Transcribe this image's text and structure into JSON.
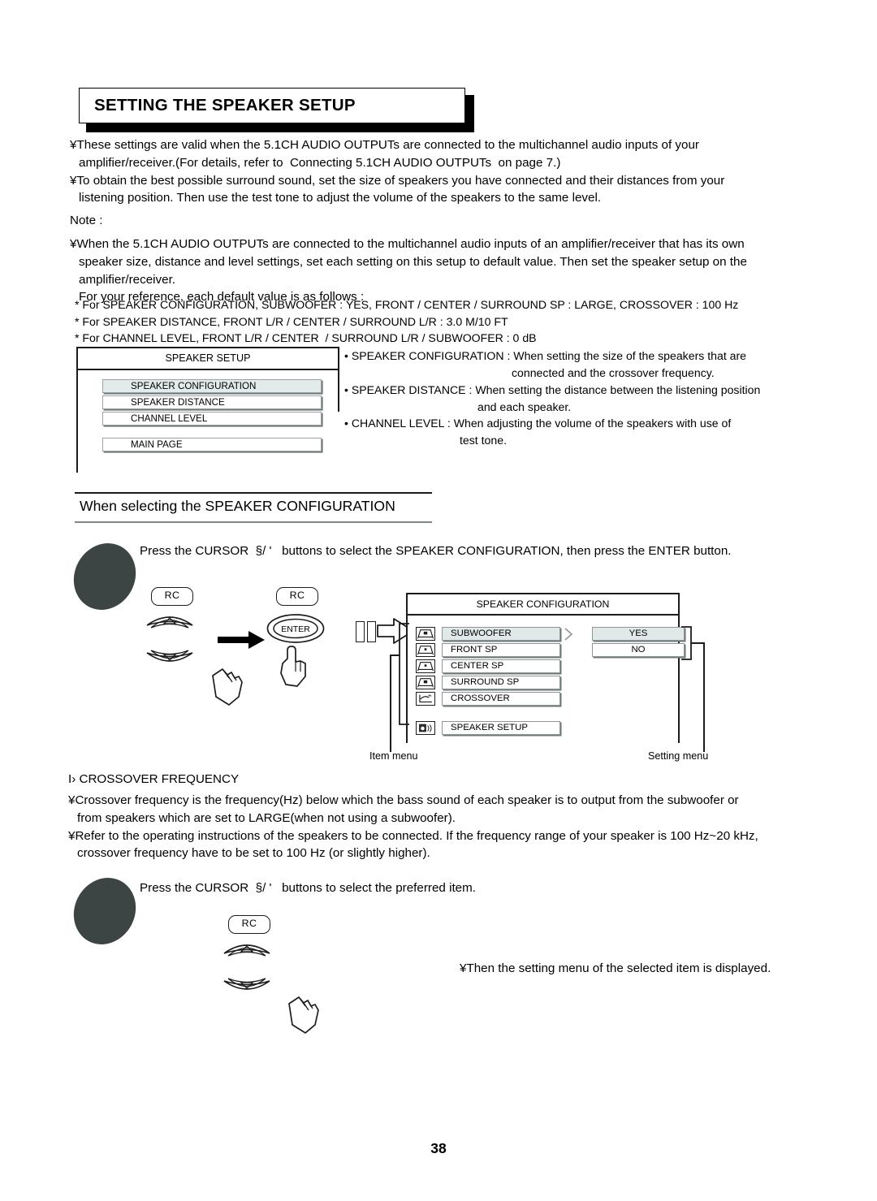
{
  "title": "SETTING THE SPEAKER SETUP",
  "page_number": "38",
  "intro": {
    "bullet1_line1": "¥These settings are valid when the 5.1CH AUDIO OUTPUTs are connected to the multichannel audio inputs of your",
    "bullet1_line2": "amplifier/receiver.(For details, refer to  Connecting 5.1CH AUDIO OUTPUTs  on page 7.)",
    "bullet2_line1": "¥To obtain the best possible surround sound, set the size of speakers you have connected and their distances from your",
    "bullet2_line2": "listening position. Then use the test tone to adjust the volume of the speakers to the same level."
  },
  "note": {
    "label": "Note :",
    "line1": "¥When the 5.1CH AUDIO OUTPUTs are connected to the multichannel audio inputs of an amplifier/receiver that has its own",
    "line2": "speaker size, distance and level settings, set each setting on this setup to default value. Then set the speaker setup on the",
    "line3": "amplifier/receiver.",
    "line4": "For your reference, each default value is as follows :",
    "default1": "* For SPEAKER CONFIGURATION, SUBWOOFER : YES, FRONT / CENTER / SURROUND SP : LARGE, CROSSOVER : 100 Hz",
    "default2": "* For SPEAKER DISTANCE, FRONT L/R / CENTER / SURROUND L/R : 3.0 M/10 FT",
    "default3": "* For CHANNEL LEVEL, FRONT L/R / CENTER  / SURROUND L/R / SUBWOOFER : 0 dB"
  },
  "speaker_setup_menu": {
    "header": "SPEAKER SETUP",
    "items": [
      {
        "label": "SPEAKER CONFIGURATION",
        "selected": true
      },
      {
        "label": "SPEAKER DISTANCE",
        "selected": false
      },
      {
        "label": "CHANNEL LEVEL",
        "selected": false
      },
      {
        "label": "MAIN PAGE",
        "selected": false
      }
    ]
  },
  "descriptions": [
    {
      "bullet": "•",
      "line1": "SPEAKER CONFIGURATION : When setting the size of the speakers that are",
      "line2": "connected and the crossover frequency."
    },
    {
      "bullet": "•",
      "line1": "SPEAKER DISTANCE : When setting the distance between the listening position",
      "line2": "and each speaker."
    },
    {
      "bullet": "•",
      "line1": "CHANNEL LEVEL : When adjusting the volume of the speakers with use of",
      "line2": "test tone."
    }
  ],
  "section_heading": "When selecting the SPEAKER CONFIGURATION",
  "step1": {
    "instruction": "Press the CURSOR  §/ '   buttons to select the SPEAKER CONFIGURATION, then press the ENTER button.",
    "rc_label_1": "RC",
    "rc_label_2": "RC",
    "enter_label": "ENTER"
  },
  "speaker_config_osd": {
    "header": "SPEAKER CONFIGURATION",
    "items": [
      {
        "label": "SUBWOOFER",
        "icon": "speaker-icon",
        "selected": true
      },
      {
        "label": "FRONT SP",
        "icon": "speaker-icon",
        "selected": false
      },
      {
        "label": "CENTER SP",
        "icon": "speaker-icon",
        "selected": false
      },
      {
        "label": "SURROUND SP",
        "icon": "speaker-icon",
        "selected": false
      },
      {
        "label": "CROSSOVER",
        "icon": "crossover-icon",
        "selected": false
      }
    ],
    "footer_item": {
      "label": "SPEAKER SETUP",
      "icon": "speaker-setup-icon"
    },
    "options": [
      {
        "label": "YES",
        "selected": true
      },
      {
        "label": "NO",
        "selected": false
      }
    ],
    "caption_left": "Item menu",
    "caption_right": "Setting menu"
  },
  "crossover": {
    "heading": "I› CROSSOVER FREQUENCY",
    "line1": "¥Crossover frequency is the frequency(Hz) below which the bass sound of each speaker is to output from the subwoofer or",
    "line2": "from speakers which are set to LARGE(when not using a subwoofer).",
    "line3": "¥Refer to the operating instructions of the speakers to be connected. If the frequency range of your speaker is 100 Hz~20 kHz,",
    "line4": "crossover frequency have to be set to 100 Hz (or slightly higher)."
  },
  "step2": {
    "instruction": "Press the CURSOR  §/ '   buttons to select the preferred item.",
    "rc_label": "RC",
    "result": "¥Then the setting menu of the selected item is displayed."
  },
  "colors": {
    "ink": "#000000",
    "highlight": "#e3eaea",
    "shadow": "#6f7878",
    "step_marker": "#3c4444"
  }
}
